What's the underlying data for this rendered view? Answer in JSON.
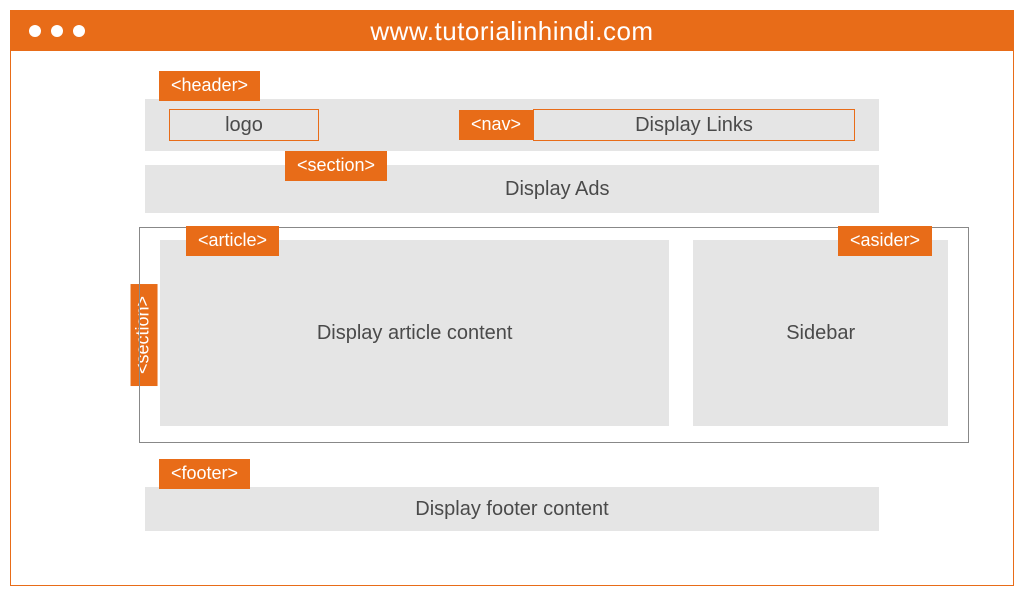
{
  "titlebar": {
    "url": "www.tutorialinhindi.com"
  },
  "header": {
    "tag": "<header>",
    "logo": "logo",
    "nav_tag": "<nav>",
    "links": "Display Links"
  },
  "ads": {
    "tag": "<section>",
    "text": "Display Ads"
  },
  "main": {
    "section_tag": "<section>",
    "article_tag": "<article>",
    "article_text": "Display article content",
    "aside_tag": "<asider>",
    "aside_text": "Sidebar"
  },
  "footer": {
    "tag": "<footer>",
    "text": "Display footer content"
  }
}
